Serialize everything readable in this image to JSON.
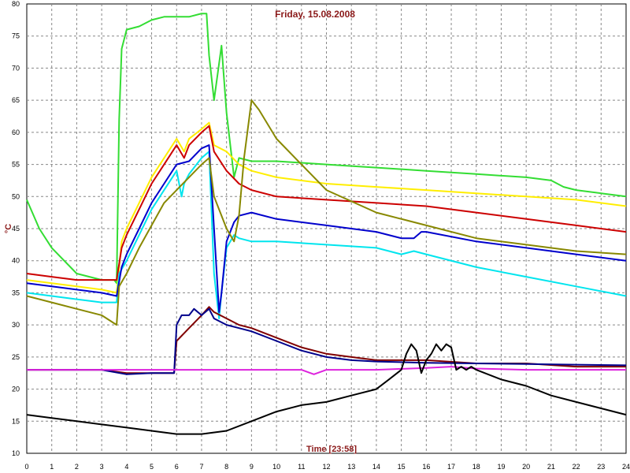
{
  "chart_data": {
    "type": "line",
    "title": "Friday, 15.08.2008",
    "xlabel": "Time [23:58]",
    "ylabel": "°C",
    "xlim": [
      0,
      24
    ],
    "ylim": [
      10,
      80
    ],
    "grid": true,
    "x_ticks": [
      "0",
      "1",
      "2",
      "3",
      "4",
      "5",
      "6",
      "7",
      "8",
      "9",
      "10",
      "11",
      "12",
      "13",
      "14",
      "15",
      "16",
      "17",
      "18",
      "19",
      "20",
      "21",
      "22",
      "23",
      "24"
    ],
    "y_ticks": [
      "10",
      "15",
      "20",
      "25",
      "30",
      "35",
      "40",
      "45",
      "50",
      "55",
      "60",
      "65",
      "70",
      "75",
      "80"
    ],
    "series": [
      {
        "color": "#33dd33",
        "x": [
          0,
          0.5,
          1,
          2,
          3,
          3.5,
          3.6,
          3.7,
          3.8,
          4,
          4.5,
          5,
          5.5,
          6,
          6.5,
          7,
          7.2,
          7.3,
          7.5,
          7.8,
          8,
          8.3,
          8.5,
          9,
          10,
          12,
          14,
          16,
          18,
          20,
          21,
          21.5,
          22,
          23,
          24
        ],
        "y": [
          49.5,
          45,
          42,
          38,
          37,
          37,
          36.5,
          62,
          73,
          76,
          76.5,
          77.5,
          78,
          78,
          78,
          78.5,
          78.5,
          72,
          65,
          73.5,
          63,
          53,
          56,
          55.5,
          55.5,
          55,
          54.5,
          54,
          53.5,
          53,
          52.5,
          51.5,
          51,
          50.5,
          50
        ]
      },
      {
        "color": "#ffee00",
        "x": [
          0,
          1,
          2,
          3,
          3.6,
          3.8,
          4,
          4.5,
          5,
          5.5,
          6,
          6.3,
          6.5,
          7,
          7.3,
          7.5,
          8,
          8.5,
          9,
          10,
          12,
          14,
          16,
          18,
          20,
          22,
          24
        ],
        "y": [
          37,
          36.5,
          36,
          35.5,
          35,
          43,
          45,
          49,
          53,
          56,
          59,
          57,
          59,
          60.5,
          61.5,
          58,
          57,
          55,
          54,
          53,
          52,
          51.5,
          51,
          50.5,
          50,
          49.5,
          48.5
        ]
      },
      {
        "color": "#cc0000",
        "x": [
          0,
          1,
          2,
          3,
          3.6,
          3.8,
          4,
          4.5,
          5,
          5.5,
          6,
          6.3,
          6.5,
          7,
          7.3,
          7.5,
          8,
          8.5,
          9,
          10,
          12,
          14,
          16,
          18,
          20,
          22,
          24
        ],
        "y": [
          38,
          37.5,
          37,
          37,
          37,
          42,
          44,
          48,
          52,
          55,
          58,
          56,
          58,
          60,
          61,
          57,
          54,
          52,
          51,
          50,
          49.5,
          49,
          48.5,
          47.5,
          46.5,
          45.5,
          44.5
        ]
      },
      {
        "color": "#00e5ee",
        "x": [
          0,
          1,
          2,
          3,
          3.6,
          3.7,
          4,
          4.5,
          5,
          5.5,
          6,
          6.2,
          6.3,
          6.5,
          7,
          7.3,
          7.5,
          7.7,
          7.8,
          8,
          8.3,
          8.5,
          9,
          10,
          12,
          14,
          15,
          15.5,
          16,
          18,
          20,
          22,
          24
        ],
        "y": [
          35,
          34.5,
          34,
          33.5,
          33.5,
          38,
          40,
          44,
          48,
          51,
          54,
          50,
          52,
          53.5,
          56,
          57,
          38,
          31,
          35,
          42,
          44,
          43.5,
          43,
          43,
          42.5,
          42,
          41,
          41.5,
          41,
          39,
          37.5,
          36,
          34.5
        ]
      },
      {
        "color": "#0000cc",
        "x": [
          0,
          1,
          2,
          3,
          3.6,
          3.8,
          4,
          4.5,
          5,
          5.5,
          6,
          6.5,
          7,
          7.3,
          7.5,
          7.7,
          7.8,
          8,
          8.3,
          8.5,
          9,
          10,
          12,
          14,
          15,
          15.5,
          15.8,
          16,
          18,
          20,
          22,
          24
        ],
        "y": [
          36.5,
          36,
          35.5,
          35,
          34.5,
          39,
          41,
          45,
          49,
          52,
          55,
          55.5,
          57.5,
          58,
          45,
          32,
          35,
          43,
          46,
          47,
          47.5,
          46.5,
          45.5,
          44.5,
          43.5,
          43.5,
          44.5,
          44.5,
          43,
          42,
          41,
          40
        ]
      },
      {
        "color": "#888800",
        "x": [
          0,
          1,
          2,
          3,
          3.6,
          3.7,
          4,
          4.5,
          5,
          5.5,
          6,
          6.5,
          7,
          7.3,
          7.5,
          8,
          8.3,
          8.5,
          8.7,
          9,
          9.3,
          10,
          11,
          12,
          14,
          16,
          18,
          20,
          22,
          24
        ],
        "y": [
          34.5,
          33.5,
          32.5,
          31.5,
          30,
          36,
          38,
          42,
          45.5,
          49,
          51,
          53,
          55,
          56,
          50,
          45,
          43,
          47,
          56,
          65,
          63.5,
          59,
          55,
          51,
          47.5,
          45.5,
          43.5,
          42.5,
          41.5,
          41
        ]
      },
      {
        "color": "#800000",
        "x": [
          0,
          1,
          2,
          3,
          4,
          5,
          5.9,
          6,
          6.5,
          7,
          7.3,
          7.5,
          8,
          8.5,
          9,
          10,
          11,
          12,
          13,
          14,
          16,
          18,
          20,
          22,
          24
        ],
        "y": [
          23,
          23,
          23,
          23,
          22.5,
          22.5,
          22.5,
          27.5,
          29.5,
          31.5,
          32.8,
          32,
          31,
          30,
          29.5,
          28,
          26.5,
          25.5,
          25,
          24.5,
          24.5,
          24,
          24,
          23.5,
          23.5
        ]
      },
      {
        "color": "#00008b",
        "x": [
          0,
          1,
          2,
          3,
          4,
          5,
          5.9,
          6,
          6.2,
          6.5,
          6.7,
          7,
          7.3,
          7.5,
          8,
          8.5,
          9,
          10,
          11,
          12,
          13,
          14,
          16,
          18,
          20,
          22,
          24
        ],
        "y": [
          23,
          23,
          23,
          23,
          22.3,
          22.5,
          22.5,
          30,
          31.5,
          31.5,
          32.5,
          31.5,
          32.5,
          31,
          30,
          29.5,
          29,
          27.5,
          26,
          25,
          24.5,
          24.3,
          24.1,
          24,
          23.9,
          23.8,
          23.7
        ]
      },
      {
        "color": "#dd22dd",
        "x": [
          0,
          2,
          4,
          6,
          8,
          10,
          11,
          11.5,
          12,
          14,
          16,
          17,
          18,
          20,
          22,
          24
        ],
        "y": [
          23,
          23,
          23,
          23,
          23,
          23,
          23,
          22.3,
          23,
          23,
          23.3,
          23.5,
          23.2,
          23,
          23,
          23
        ]
      },
      {
        "color": "#000000",
        "x": [
          0,
          1,
          2,
          3,
          4,
          5,
          6,
          7,
          8,
          9,
          10,
          11,
          12,
          13,
          14,
          14.5,
          15,
          15.2,
          15.4,
          15.6,
          15.8,
          16,
          16.2,
          16.4,
          16.6,
          16.8,
          17,
          17.2,
          17.4,
          17.6,
          17.8,
          18,
          19,
          20,
          21,
          22,
          23,
          24
        ],
        "y": [
          16,
          15.5,
          15,
          14.5,
          14,
          13.5,
          13,
          13,
          13.5,
          15,
          16.5,
          17.5,
          18,
          19,
          20,
          21.5,
          23,
          25.5,
          27,
          26,
          22.5,
          24.5,
          25.5,
          27,
          26,
          27,
          26.5,
          23,
          23.5,
          23,
          23.5,
          23,
          21.5,
          20.5,
          19,
          18,
          17,
          16
        ]
      }
    ]
  }
}
